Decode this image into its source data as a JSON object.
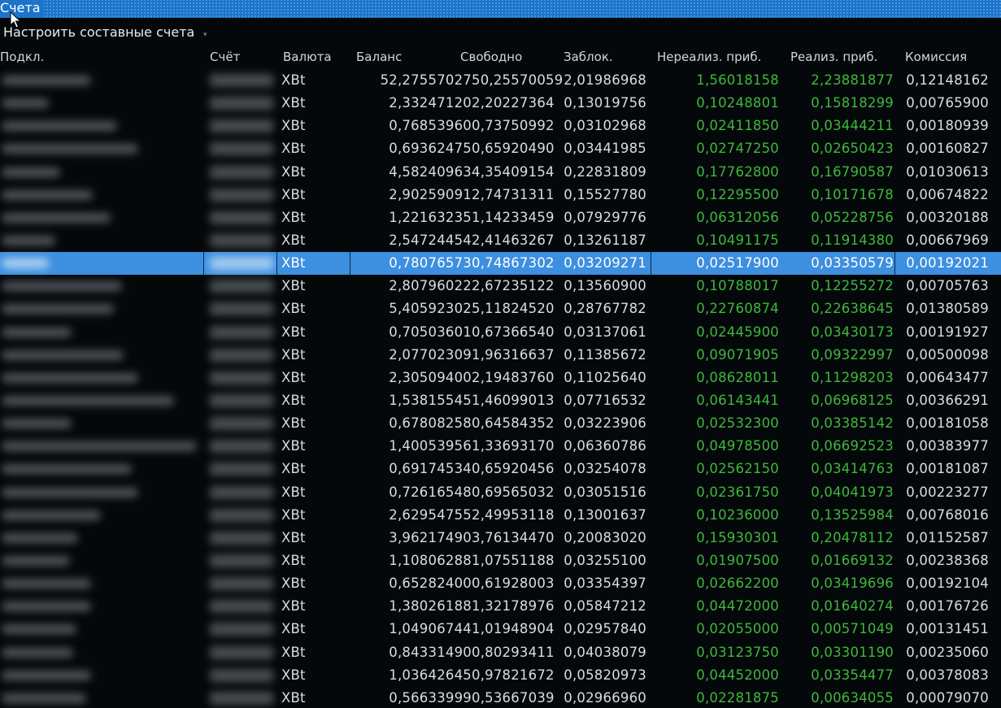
{
  "window": {
    "title": "Счета"
  },
  "toolbar": {
    "composite_label": "Настроить составные счета"
  },
  "columns": {
    "subaccount": "Подкл.",
    "account": "Счёт",
    "currency": "Валюта",
    "balance": "Баланс",
    "free": "Свободно",
    "blocked": "Заблок.",
    "unrealized": "Нереализ. приб.",
    "realized": "Реализ. приб.",
    "commission": "Комиссия"
  },
  "colors": {
    "accent": "#1b74c9",
    "selected_row": "#3d8fe0",
    "profit": "#3fb83a",
    "background": "#05080b"
  },
  "icons": {
    "cursor": "mouse-pointer-icon",
    "sort": "chevron-down-icon"
  },
  "selected_row_index": 8,
  "rows": [
    {
      "currency": "XBt",
      "balance": "52,27557027",
      "free": "50,25570059",
      "blocked": "2,01986968",
      "unrealized": "1,56018158",
      "realized": "2,23881877",
      "commission": "0,12148162"
    },
    {
      "currency": "XBt",
      "balance": "2,33247120",
      "free": "2,20227364",
      "blocked": "0,13019756",
      "unrealized": "0,10248801",
      "realized": "0,15818299",
      "commission": "0,00765900"
    },
    {
      "currency": "XBt",
      "balance": "0,76853960",
      "free": "0,73750992",
      "blocked": "0,03102968",
      "unrealized": "0,02411850",
      "realized": "0,03444211",
      "commission": "0,00180939"
    },
    {
      "currency": "XBt",
      "balance": "0,69362475",
      "free": "0,65920490",
      "blocked": "0,03441985",
      "unrealized": "0,02747250",
      "realized": "0,02650423",
      "commission": "0,00160827"
    },
    {
      "currency": "XBt",
      "balance": "4,58240963",
      "free": "4,35409154",
      "blocked": "0,22831809",
      "unrealized": "0,17762800",
      "realized": "0,16790587",
      "commission": "0,01030613"
    },
    {
      "currency": "XBt",
      "balance": "2,90259091",
      "free": "2,74731311",
      "blocked": "0,15527780",
      "unrealized": "0,12295500",
      "realized": "0,10171678",
      "commission": "0,00674822"
    },
    {
      "currency": "XBt",
      "balance": "1,22163235",
      "free": "1,14233459",
      "blocked": "0,07929776",
      "unrealized": "0,06312056",
      "realized": "0,05228756",
      "commission": "0,00320188"
    },
    {
      "currency": "XBt",
      "balance": "2,54724454",
      "free": "2,41463267",
      "blocked": "0,13261187",
      "unrealized": "0,10491175",
      "realized": "0,11914380",
      "commission": "0,00667969"
    },
    {
      "currency": "XBt",
      "balance": "0,78076573",
      "free": "0,74867302",
      "blocked": "0,03209271",
      "unrealized": "0,02517900",
      "realized": "0,03350579",
      "commission": "0,00192021"
    },
    {
      "currency": "XBt",
      "balance": "2,80796022",
      "free": "2,67235122",
      "blocked": "0,13560900",
      "unrealized": "0,10788017",
      "realized": "0,12255272",
      "commission": "0,00705763"
    },
    {
      "currency": "XBt",
      "balance": "5,40592302",
      "free": "5,11824520",
      "blocked": "0,28767782",
      "unrealized": "0,22760874",
      "realized": "0,22638645",
      "commission": "0,01380589"
    },
    {
      "currency": "XBt",
      "balance": "0,70503601",
      "free": "0,67366540",
      "blocked": "0,03137061",
      "unrealized": "0,02445900",
      "realized": "0,03430173",
      "commission": "0,00191927"
    },
    {
      "currency": "XBt",
      "balance": "2,07702309",
      "free": "1,96316637",
      "blocked": "0,11385672",
      "unrealized": "0,09071905",
      "realized": "0,09322997",
      "commission": "0,00500098"
    },
    {
      "currency": "XBt",
      "balance": "2,30509400",
      "free": "2,19483760",
      "blocked": "0,11025640",
      "unrealized": "0,08628011",
      "realized": "0,11298203",
      "commission": "0,00643477"
    },
    {
      "currency": "XBt",
      "balance": "1,53815545",
      "free": "1,46099013",
      "blocked": "0,07716532",
      "unrealized": "0,06143441",
      "realized": "0,06968125",
      "commission": "0,00366291"
    },
    {
      "currency": "XBt",
      "balance": "0,67808258",
      "free": "0,64584352",
      "blocked": "0,03223906",
      "unrealized": "0,02532300",
      "realized": "0,03385142",
      "commission": "0,00181058"
    },
    {
      "currency": "XBt",
      "balance": "1,40053956",
      "free": "1,33693170",
      "blocked": "0,06360786",
      "unrealized": "0,04978500",
      "realized": "0,06692523",
      "commission": "0,00383977"
    },
    {
      "currency": "XBt",
      "balance": "0,69174534",
      "free": "0,65920456",
      "blocked": "0,03254078",
      "unrealized": "0,02562150",
      "realized": "0,03414763",
      "commission": "0,00181087"
    },
    {
      "currency": "XBt",
      "balance": "0,72616548",
      "free": "0,69565032",
      "blocked": "0,03051516",
      "unrealized": "0,02361750",
      "realized": "0,04041973",
      "commission": "0,00223277"
    },
    {
      "currency": "XBt",
      "balance": "2,62954755",
      "free": "2,49953118",
      "blocked": "0,13001637",
      "unrealized": "0,10236000",
      "realized": "0,13525984",
      "commission": "0,00768016"
    },
    {
      "currency": "XBt",
      "balance": "3,96217490",
      "free": "3,76134470",
      "blocked": "0,20083020",
      "unrealized": "0,15930301",
      "realized": "0,20478112",
      "commission": "0,01152587"
    },
    {
      "currency": "XBt",
      "balance": "1,10806288",
      "free": "1,07551188",
      "blocked": "0,03255100",
      "unrealized": "0,01907500",
      "realized": "0,01669132",
      "commission": "0,00238368"
    },
    {
      "currency": "XBt",
      "balance": "0,65282400",
      "free": "0,61928003",
      "blocked": "0,03354397",
      "unrealized": "0,02662200",
      "realized": "0,03419696",
      "commission": "0,00192104"
    },
    {
      "currency": "XBt",
      "balance": "1,38026188",
      "free": "1,32178976",
      "blocked": "0,05847212",
      "unrealized": "0,04472000",
      "realized": "0,01640274",
      "commission": "0,00176726"
    },
    {
      "currency": "XBt",
      "balance": "1,04906744",
      "free": "1,01948904",
      "blocked": "0,02957840",
      "unrealized": "0,02055000",
      "realized": "0,00571049",
      "commission": "0,00131451"
    },
    {
      "currency": "XBt",
      "balance": "0,84331490",
      "free": "0,80293411",
      "blocked": "0,04038079",
      "unrealized": "0,03123750",
      "realized": "0,03301190",
      "commission": "0,00235060"
    },
    {
      "currency": "XBt",
      "balance": "1,03642645",
      "free": "0,97821672",
      "blocked": "0,05820973",
      "unrealized": "0,04452000",
      "realized": "0,03354477",
      "commission": "0,00378083"
    },
    {
      "currency": "XBt",
      "balance": "0,56633999",
      "free": "0,53667039",
      "blocked": "0,02966960",
      "unrealized": "0,02281875",
      "realized": "0,00634055",
      "commission": "0,00079070"
    }
  ]
}
